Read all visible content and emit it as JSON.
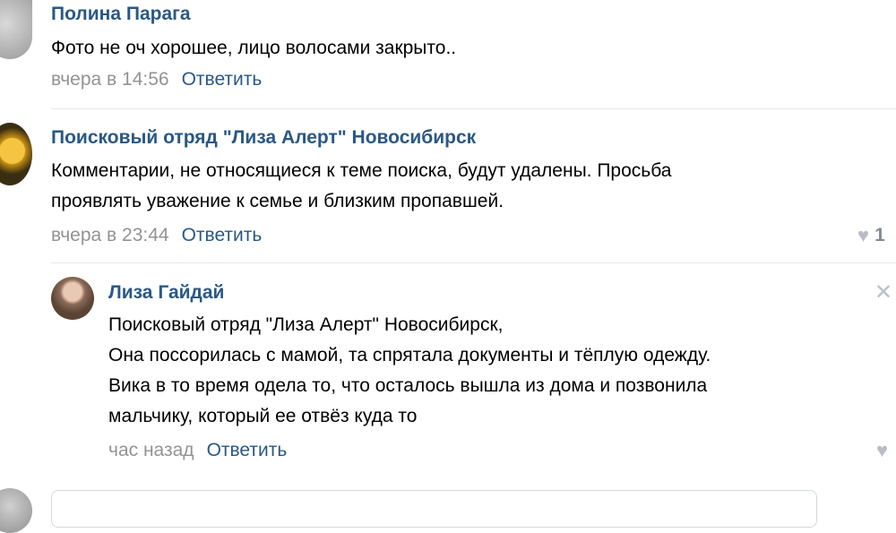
{
  "comments": [
    {
      "author": "Полина Парага",
      "text": "Фото не оч хорошее, лицо волосами закрыто..",
      "time": "вчера в 14:56",
      "reply_label": "Ответить"
    },
    {
      "author": "Поисковый отряд \"Лиза Алерт\" Новосибирск",
      "text_lines": [
        "Комментарии, не относящиеся к теме поиска, будут удалены. Просьба",
        "проявлять уважение к семье и близким пропавшей."
      ],
      "time": "вчера в 23:44",
      "reply_label": "Ответить",
      "likes": "1"
    },
    {
      "author": "Лиза Гайдай",
      "text_lines": [
        "Поисковый отряд \"Лиза Алерт\" Новосибирск,",
        "Она поссорилась с мамой, та спрятала документы и тёплую одежду.",
        "Вика в то время одела то, что осталось вышла из дома и позвонила",
        "мальчику, который ее отвёз куда то"
      ],
      "time": "час назад",
      "reply_label": "Ответить"
    }
  ],
  "icons": {
    "like": "heart-icon",
    "close": "close-icon"
  },
  "colors": {
    "link": "#2a5885",
    "meta": "#939393",
    "separator": "#e7e8ec"
  }
}
